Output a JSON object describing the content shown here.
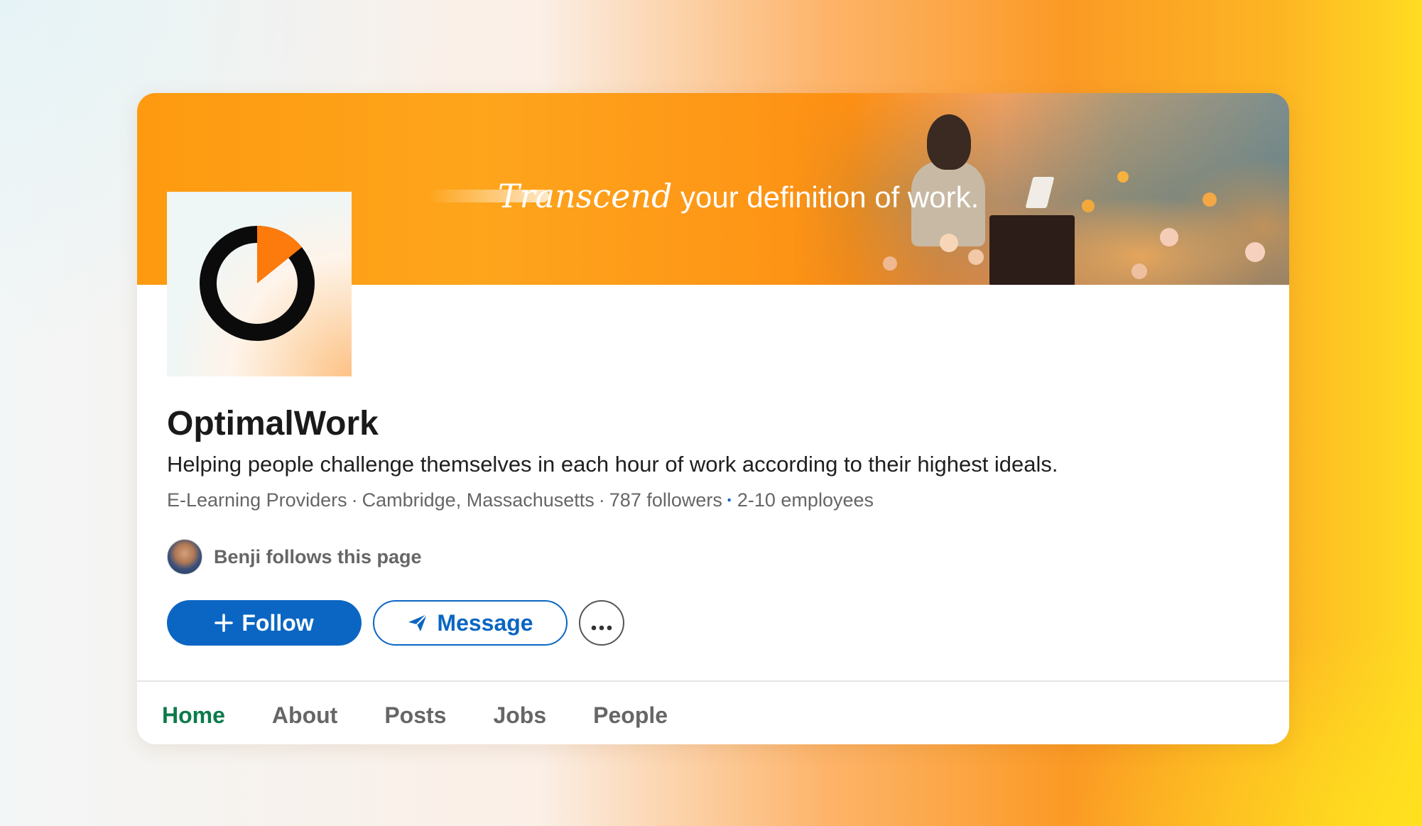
{
  "banner": {
    "tagline_emphasis": "Transcend",
    "tagline_rest": " your definition of work."
  },
  "company": {
    "name": "OptimalWork",
    "description": "Helping people challenge themselves in each hour of work according to their highest ideals.",
    "industry": "E-Learning Providers",
    "location": "Cambridge, Massachusetts",
    "followers": "787 followers",
    "employees": "2-10 employees",
    "separator": "·"
  },
  "follower": {
    "text": "Benji follows this page"
  },
  "actions": {
    "follow_label": "Follow",
    "message_label": "Message"
  },
  "tabs": [
    {
      "label": "Home",
      "active": true
    },
    {
      "label": "About",
      "active": false
    },
    {
      "label": "Posts",
      "active": false
    },
    {
      "label": "Jobs",
      "active": false
    },
    {
      "label": "People",
      "active": false
    }
  ],
  "colors": {
    "brand_orange": "#fe9a10",
    "linkedin_blue": "#0a66c2",
    "active_tab_green": "#0d7a4a"
  },
  "icons": {
    "logo": "optimalwork-ring-logo",
    "follow": "plus-icon",
    "message": "paper-plane-icon",
    "more": "more-horizontal-icon"
  }
}
